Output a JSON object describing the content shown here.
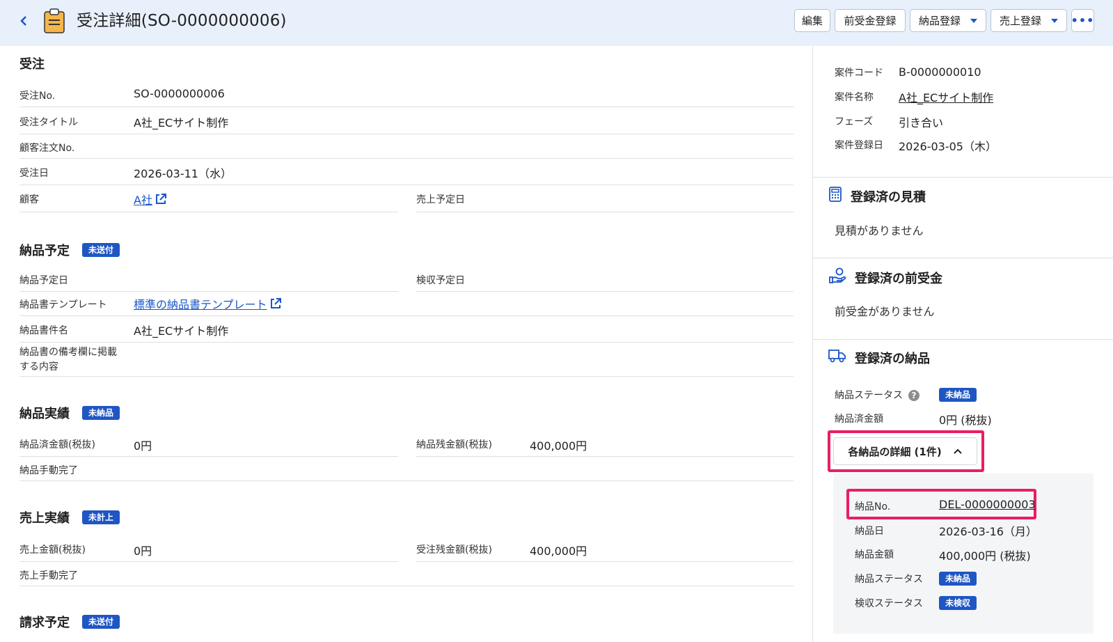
{
  "header": {
    "title": "受注詳細(SO-0000000006)",
    "buttons": {
      "edit": "編集",
      "advance": "前受金登録",
      "delivery": "納品登録",
      "sales": "売上登録"
    }
  },
  "order": {
    "section_title": "受注",
    "fields": {
      "no_label": "受注No.",
      "no_value": "SO-0000000006",
      "title_label": "受注タイトル",
      "title_value": "A社_ECサイト制作",
      "customer_order_label": "顧客注文No.",
      "date_label": "受注日",
      "date_value": "2026-03-11（水）",
      "customer_label": "顧客",
      "customer_value": "A社",
      "sales_date_label": "売上予定日"
    }
  },
  "delivery_plan": {
    "section_title": "納品予定",
    "badge": "未送付",
    "fields": {
      "plan_date_label": "納品予定日",
      "inspection_date_label": "検収予定日",
      "template_label": "納品書テンプレート",
      "template_value": "標準の納品書テンプレート",
      "doc_name_label": "納品書件名",
      "doc_name_value": "A社_ECサイト制作",
      "remarks_label_1": "納品書の備考欄に掲載",
      "remarks_label_2": "する内容"
    }
  },
  "delivery_result": {
    "section_title": "納品実績",
    "badge": "未納品",
    "fields": {
      "delivered_label": "納品済金額(税抜)",
      "delivered_value": "0円",
      "remaining_label": "納品残金額(税抜)",
      "remaining_value": "400,000円",
      "manual_label": "納品手動完了"
    }
  },
  "sales_result": {
    "section_title": "売上実績",
    "badge": "未計上",
    "fields": {
      "sales_label": "売上金額(税抜)",
      "sales_value": "0円",
      "remaining_label": "受注残金額(税抜)",
      "remaining_value": "400,000円",
      "manual_label": "売上手動完了"
    }
  },
  "billing_plan": {
    "section_title": "請求予定",
    "badge": "未送付"
  },
  "side": {
    "project": {
      "code_label": "案件コード",
      "code_value": "B-0000000010",
      "name_label": "案件名称",
      "name_value": "A社_ECサイト制作",
      "phase_label": "フェーズ",
      "phase_value": "引き合い",
      "reg_date_label": "案件登録日",
      "reg_date_value": "2026-03-05（木）"
    },
    "estimates": {
      "title": "登録済の見積",
      "empty": "見積がありません"
    },
    "advances": {
      "title": "登録済の前受金",
      "empty": "前受金がありません"
    },
    "deliveries": {
      "title": "登録済の納品",
      "status_label": "納品ステータス",
      "status_badge": "未納品",
      "amount_label": "納品済金額",
      "amount_value": "0円 (税抜)",
      "toggle_label": "各納品の詳細 (1件)",
      "detail": {
        "no_label": "納品No.",
        "no_value": "DEL-0000000003",
        "date_label": "納品日",
        "date_value": "2026-03-16（月）",
        "amount_label": "納品金額",
        "amount_value": "400,000円 (税抜)",
        "status_label": "納品ステータス",
        "status_badge": "未納品",
        "inspection_label": "検収ステータス",
        "inspection_badge": "未検収"
      }
    }
  },
  "colors": {
    "header_bg": "#e8f0fb",
    "badge": "#1f56c3",
    "link": "#1a56c9",
    "highlight": "#e91e63"
  }
}
